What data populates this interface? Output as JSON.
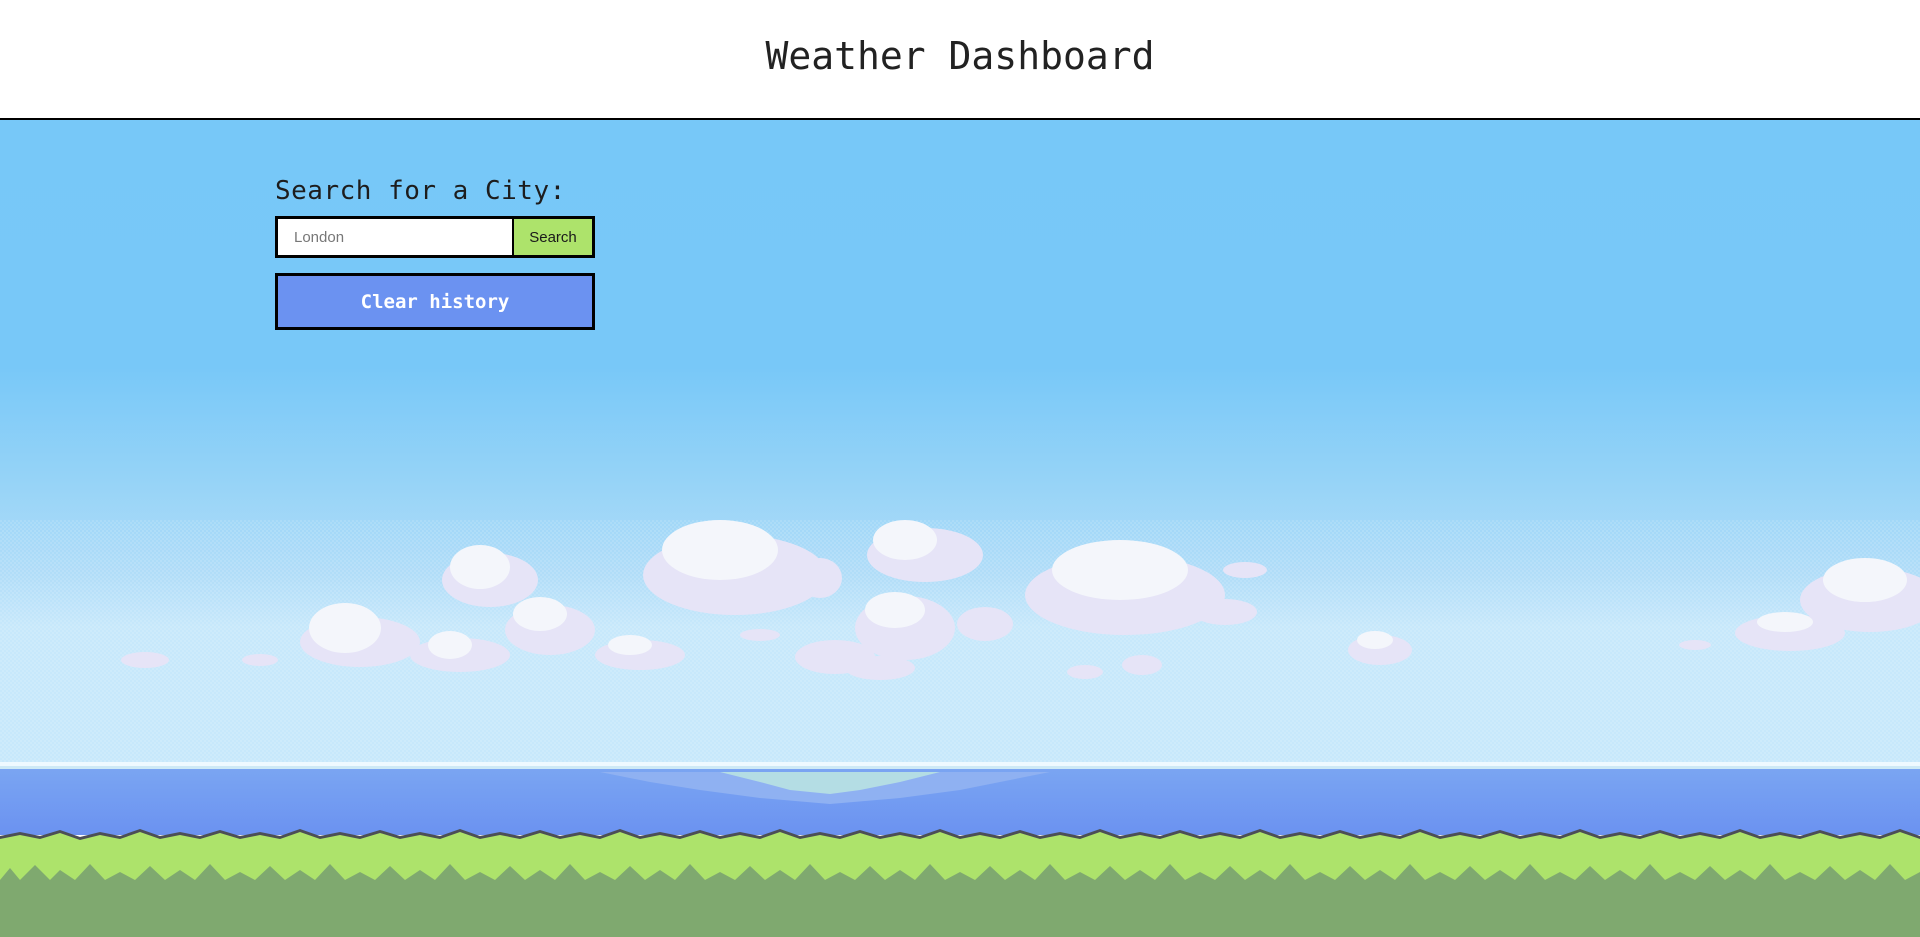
{
  "header": {
    "title": "Weather Dashboard"
  },
  "search": {
    "label": "Search for a City:",
    "placeholder": "London",
    "value": "",
    "button_label": "Search"
  },
  "history": {
    "clear_label": "Clear history"
  },
  "colors": {
    "sky": "#7ac8f7",
    "sky_horizon": "#bfe6fb",
    "water": "#6b92f1",
    "grass_light": "#ade36b",
    "grass_dark": "#7fa96f",
    "search_button": "#ade36b",
    "clear_button": "#6b92f1"
  }
}
